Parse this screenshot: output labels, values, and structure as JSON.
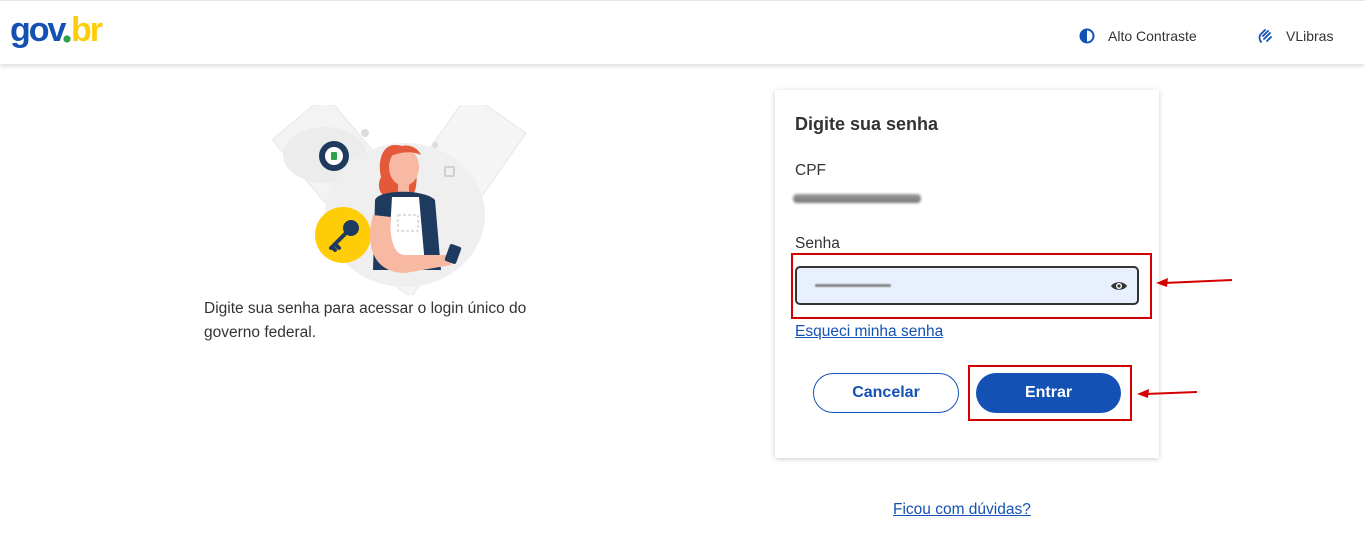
{
  "header": {
    "logo_text": "gov.br",
    "contrast_label": "Alto Contraste",
    "contrast_icon": "contrast-icon",
    "libras_label": "VLibras",
    "libras_icon": "hands-icon"
  },
  "intro": {
    "text": "Digite sua senha para acessar o login único do governo federal."
  },
  "card": {
    "title": "Digite sua senha",
    "cpf_label": "CPF",
    "senha_label": "Senha",
    "eye_icon": "eye-icon",
    "forgot_link": "Esqueci minha senha",
    "cancel_label": "Cancelar",
    "enter_label": "Entrar"
  },
  "help_link": "Ficou com dúvidas?",
  "colors": {
    "brand_blue": "#1351b4",
    "annotation_red": "#d40000",
    "input_bg": "#e8f0fe",
    "logo_yellow": "#ffcd07",
    "logo_green": "#2aa34a"
  }
}
